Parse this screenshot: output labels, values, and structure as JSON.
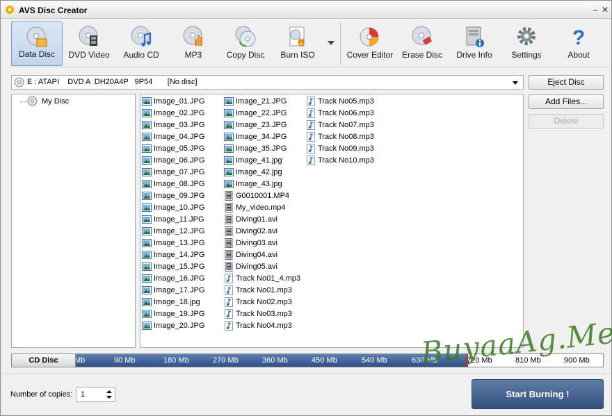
{
  "window": {
    "title": "AVS Disc Creator"
  },
  "toolbar": {
    "items": [
      {
        "label": "Data Disc",
        "icon": "data-disc-icon"
      },
      {
        "label": "DVD Video",
        "icon": "dvd-video-icon"
      },
      {
        "label": "Audio CD",
        "icon": "audio-cd-icon"
      },
      {
        "label": "MP3",
        "icon": "mp3-icon"
      },
      {
        "label": "Copy Disc",
        "icon": "copy-disc-icon"
      },
      {
        "label": "Burn ISO",
        "icon": "burn-iso-icon"
      },
      {
        "label": "Cover Editor",
        "icon": "cover-editor-icon"
      },
      {
        "label": "Erase Disc",
        "icon": "erase-disc-icon"
      },
      {
        "label": "Drive Info",
        "icon": "drive-info-icon"
      },
      {
        "label": "Settings",
        "icon": "gear-icon"
      },
      {
        "label": "About",
        "icon": "question-icon"
      }
    ]
  },
  "drive": {
    "selected": "E : ATAPI    DVD A  DH20A4P   9P54       [No disc]"
  },
  "side_buttons": {
    "eject": "Eject Disc",
    "add": "Add Files...",
    "delete": "Delete"
  },
  "tree": {
    "root": "My Disc"
  },
  "files": {
    "col1": [
      "Image_01.JPG",
      "Image_02.JPG",
      "Image_03.JPG",
      "Image_04.JPG",
      "Image_05.JPG",
      "Image_06.JPG",
      "Image_07.JPG",
      "Image_08.JPG",
      "Image_09.JPG",
      "Image_10.JPG",
      "Image_11.JPG",
      "Image_12.JPG",
      "Image_13.JPG",
      "Image_14.JPG",
      "Image_15.JPG",
      "Image_16.JPG",
      "Image_17.JPG",
      "Image_18.jpg",
      "Image_19.JPG",
      "Image_20.JPG"
    ],
    "col2": [
      "Image_21.JPG",
      "Image_22.JPG",
      "Image_23.JPG",
      "Image_34.JPG",
      "Image_35.JPG",
      "Image_41.jpg",
      "Image_42.jpg",
      "Image_43.jpg",
      "G0010001.MP4",
      "My_video.mp4",
      "Diving01.avi",
      "Diving02.avi",
      "Diving03.avi",
      "Diving04.avi",
      "Diving05.avi",
      "Track No01_4.mp3",
      "Track No01.mp3",
      "Track No02.mp3",
      "Track No03.mp3",
      "Track No04.mp3"
    ],
    "col3": [
      "Track No05.mp3",
      "Track No06.mp3",
      "Track No07.mp3",
      "Track No08.mp3",
      "Track No09.mp3",
      "Track No10.mp3"
    ],
    "col2_types": [
      "image",
      "image",
      "image",
      "image",
      "image",
      "image",
      "image",
      "image",
      "video",
      "video",
      "video",
      "video",
      "video",
      "video",
      "video",
      "audio",
      "audio",
      "audio",
      "audio",
      "audio"
    ]
  },
  "capacity": {
    "label": "CD Disc",
    "ticks": [
      "Mb",
      "90 Mb",
      "180 Mb",
      "270 Mb",
      "360 Mb",
      "450 Mb",
      "540 Mb",
      "630 Mb",
      "720 Mb",
      "810 Mb",
      "900 Mb"
    ]
  },
  "watermark": "BuyaaAg.Me",
  "copies": {
    "label": "Number of copies:",
    "value": "1"
  },
  "start_button": "Start Burning !"
}
